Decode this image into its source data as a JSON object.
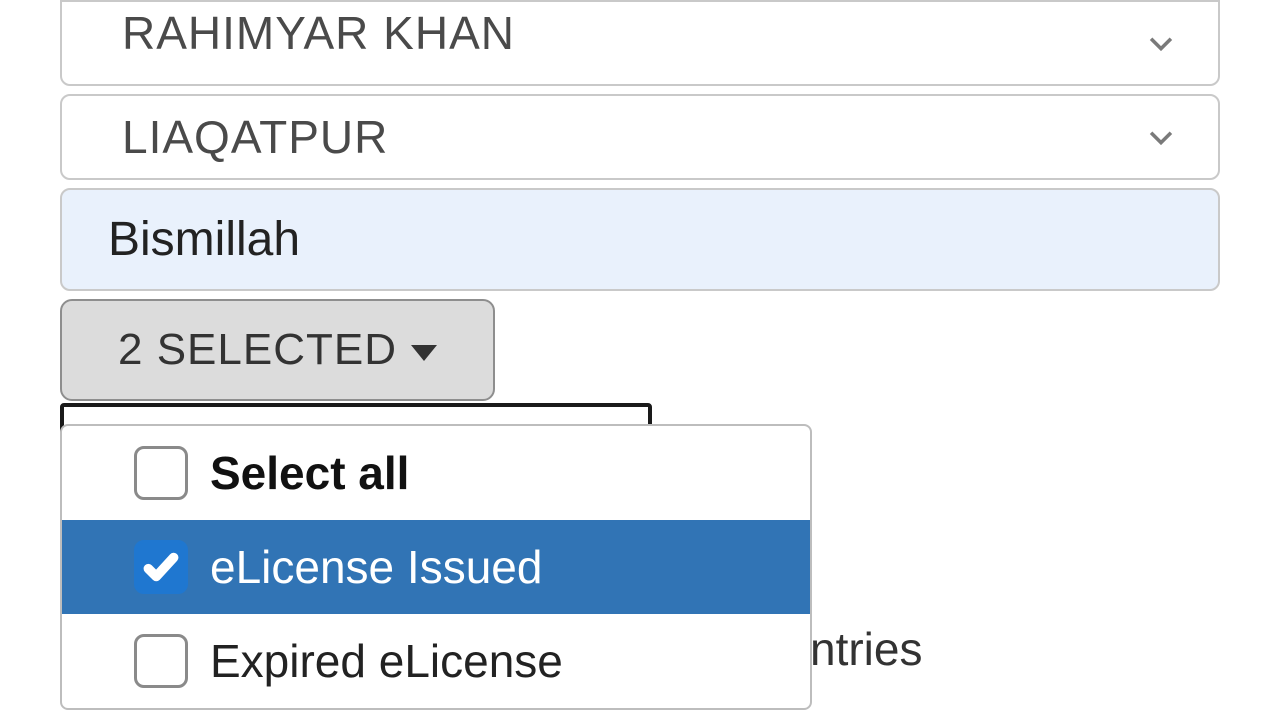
{
  "district_select": {
    "value": "RAHIMYAR KHAN"
  },
  "tehsil_select": {
    "value": "LIAQATPUR"
  },
  "search_field": {
    "value": "Bismillah"
  },
  "status_multiselect": {
    "button_label": "2 SELECTED",
    "options": {
      "select_all": {
        "label": "Select all",
        "checked": false
      },
      "elicense_issued": {
        "label": "eLicense Issued",
        "checked": true
      },
      "expired_elicense": {
        "label": "Expired eLicense",
        "checked": false
      }
    }
  },
  "entries_fragment": "ntries"
}
